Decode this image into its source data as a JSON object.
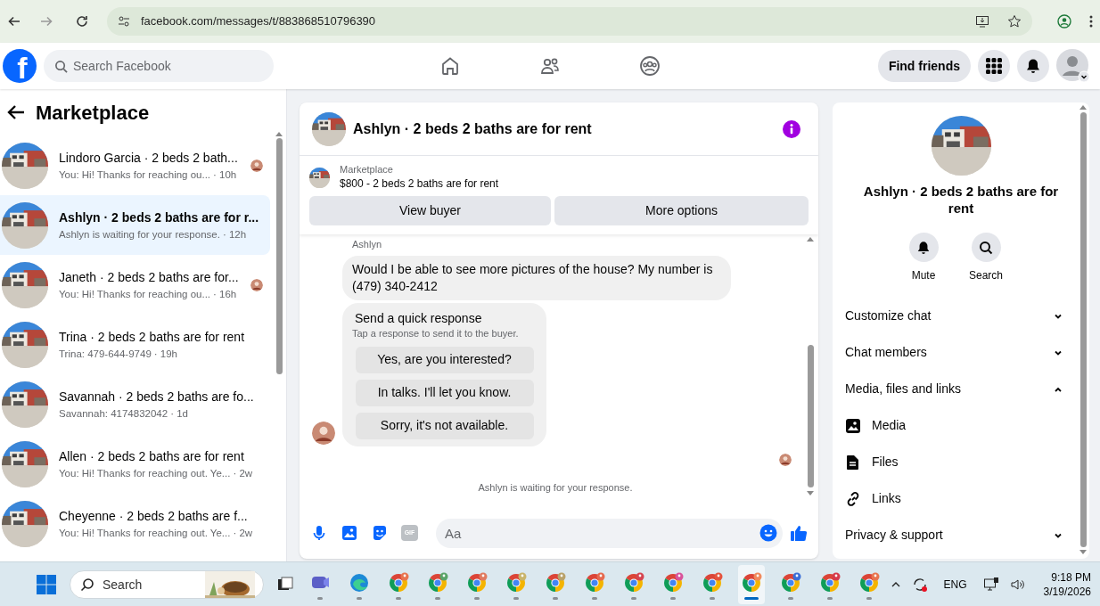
{
  "browser": {
    "url": "facebook.com/messages/t/883868510796390"
  },
  "header": {
    "logo": "f",
    "search_placeholder": "Search Facebook",
    "find_friends": "Find friends"
  },
  "sidebar": {
    "title": "Marketplace",
    "conversations": [
      {
        "title": "Lindoro Garcia · 2 beds 2 bath...",
        "preview": "You: Hi! Thanks for reaching ou...",
        "time": "· 10h",
        "selected": false,
        "seen": true
      },
      {
        "title": "Ashlyn · 2 beds 2 baths are for r...",
        "preview": "Ashlyn is waiting for your response.",
        "time": "· 12h",
        "selected": true,
        "seen": false
      },
      {
        "title": "Janeth · 2 beds 2 baths are for...",
        "preview": "You: Hi! Thanks for reaching ou...",
        "time": "· 16h",
        "selected": false,
        "seen": true
      },
      {
        "title": "Trina · 2 beds 2 baths are for rent",
        "preview": "Trina: 479-644-9749",
        "time": "· 19h",
        "selected": false,
        "seen": false
      },
      {
        "title": "Savannah · 2 beds 2 baths are fo...",
        "preview": "Savannah: 4174832042",
        "time": "· 1d",
        "selected": false,
        "seen": false
      },
      {
        "title": "Allen · 2 beds 2 baths are for rent",
        "preview": "You: Hi! Thanks for reaching out. Ye...",
        "time": "· 2w",
        "selected": false,
        "seen": false
      },
      {
        "title": "Cheyenne · 2 beds 2 baths are f...",
        "preview": "You: Hi! Thanks for reaching out. Ye...",
        "time": "· 2w",
        "selected": false,
        "seen": false
      }
    ]
  },
  "chat": {
    "title": "Ashlyn · 2 beds 2 baths are for rent",
    "listing": {
      "label": "Marketplace",
      "text": "$800 - 2 beds 2 baths are for rent"
    },
    "buttons": [
      "View buyer",
      "More options"
    ],
    "sender": "Ashlyn",
    "message": "Would I be able to see more pictures of the house? My number is (479) 340-2412",
    "quick_response": {
      "title": "Send a quick response",
      "subtitle": "Tap a response to send it to the buyer.",
      "options": [
        "Yes, are you interested?",
        "In talks. I'll let you know.",
        "Sorry, it's not available."
      ]
    },
    "status": "Ashlyn is waiting for your response.",
    "gif": "GIF",
    "composer_placeholder": "Aa"
  },
  "details": {
    "title": "Ashlyn · 2 beds 2 baths are for rent",
    "actions": [
      {
        "label": "Mute",
        "kind": "bell"
      },
      {
        "label": "Search",
        "kind": "search"
      }
    ],
    "sections": [
      {
        "label": "Customize chat",
        "expanded": false
      },
      {
        "label": "Chat members",
        "expanded": false
      },
      {
        "label": "Media, files and links",
        "expanded": true,
        "children": [
          {
            "label": "Media",
            "kind": "media"
          },
          {
            "label": "Files",
            "kind": "file"
          },
          {
            "label": "Links",
            "kind": "link"
          }
        ]
      },
      {
        "label": "Privacy & support",
        "expanded": false
      }
    ]
  },
  "taskbar": {
    "search_placeholder": "Search",
    "apps": [
      {
        "kind": "teams",
        "selected": false
      },
      {
        "kind": "edge",
        "selected": false
      },
      {
        "kind": "chrome",
        "color": "#e8744f",
        "selected": false
      },
      {
        "kind": "chrome",
        "color": "#5aa469",
        "selected": false
      },
      {
        "kind": "chrome",
        "color": "#e07a5f",
        "selected": false
      },
      {
        "kind": "chrome",
        "color": "#c9b46a",
        "selected": false
      },
      {
        "kind": "chrome",
        "color": "#b9a26a",
        "selected": false
      },
      {
        "kind": "chrome",
        "color": "#e66a4f",
        "selected": false
      },
      {
        "kind": "chrome",
        "color": "#d64550",
        "selected": false
      },
      {
        "kind": "chrome",
        "color": "#d9539a",
        "selected": false
      },
      {
        "kind": "chrome",
        "color": "#e5533d",
        "selected": false
      },
      {
        "kind": "chrome",
        "color": "#f08a5d",
        "selected": true
      },
      {
        "kind": "chrome",
        "color": "#3b6fd8",
        "selected": false
      },
      {
        "kind": "chrome",
        "color": "#d63a4a",
        "selected": false
      },
      {
        "kind": "chrome",
        "color": "#e8744f",
        "selected": false
      }
    ],
    "language": "ENG",
    "time": "9:18 PM",
    "date": "3/19/2026"
  }
}
